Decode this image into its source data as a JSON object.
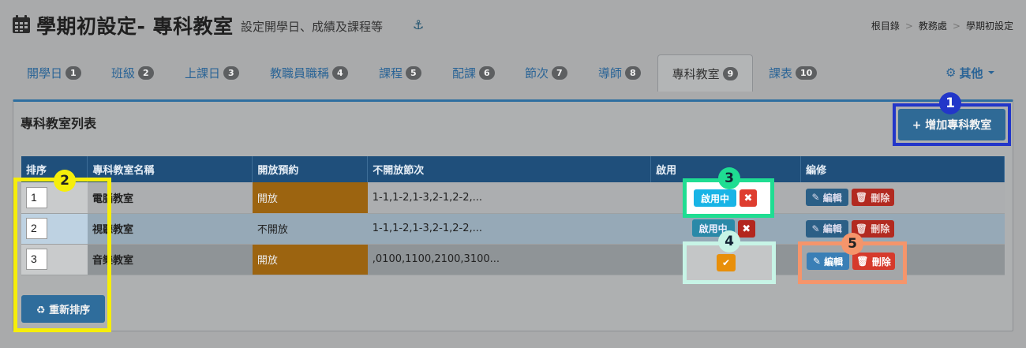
{
  "header": {
    "title": "學期初設定- 專科教室",
    "subtitle": "設定開學日、成績及課程等",
    "anchor_icon": "⚓",
    "breadcrumb": [
      "根目錄",
      "教務處",
      "學期初設定"
    ]
  },
  "tabs": [
    {
      "label": "開學日",
      "badge": "1"
    },
    {
      "label": "班級",
      "badge": "2"
    },
    {
      "label": "上課日",
      "badge": "3"
    },
    {
      "label": "教職員職稱",
      "badge": "4"
    },
    {
      "label": "課程",
      "badge": "5"
    },
    {
      "label": "配課",
      "badge": "6"
    },
    {
      "label": "節次",
      "badge": "7"
    },
    {
      "label": "導師",
      "badge": "8"
    },
    {
      "label": "專科教室",
      "badge": "9"
    },
    {
      "label": "課表",
      "badge": "10"
    }
  ],
  "other_menu": "其他",
  "panel": {
    "title": "專科教室列表",
    "add_button": "+ 增加專科教室",
    "resort_button": "♻ 重新排序"
  },
  "table": {
    "headers": [
      "排序",
      "專科教室名稱",
      "開放預約",
      "不開放節次",
      "啟用",
      "編修"
    ],
    "rows": [
      {
        "order": "1",
        "name": "電腦教室",
        "open": "開放",
        "closed_periods": "1-1,1-2,1-3,2-1,2-2,..."
      },
      {
        "order": "2",
        "name": "視聽教室",
        "open": "不開放",
        "closed_periods": "1-1,1-2,1-3,2-1,2-2,..."
      },
      {
        "order": "3",
        "name": "音樂教室",
        "open": "開放",
        "closed_periods": ",0100,1100,2100,3100..."
      }
    ],
    "enabled_label": "啟用中",
    "delete_x": "✖",
    "check": "✔",
    "edit_label": "編輯",
    "delete_label": "刪除"
  },
  "callouts": [
    "1",
    "2",
    "3",
    "4",
    "5"
  ],
  "colors": {
    "callout1": "#2236c9",
    "callout2": "#f6ee0a",
    "callout3": "#1fdd92",
    "callout4": "#c7f4e6",
    "callout5": "#f5956b"
  }
}
